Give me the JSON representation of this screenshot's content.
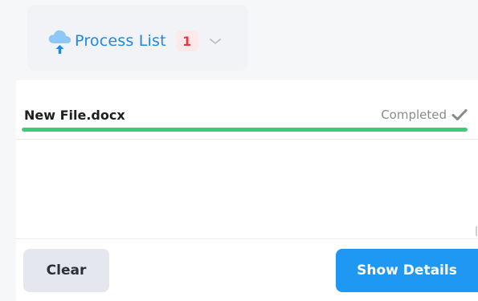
{
  "header": {
    "title": "Process List",
    "count": "1",
    "icons": {
      "cloud": "cloud-upload-icon",
      "chevron": "chevron-down-icon"
    }
  },
  "files": [
    {
      "name": "New File.docx",
      "status": "Completed",
      "progress": 1.0
    }
  ],
  "footer": {
    "clear_label": "Clear",
    "show_details_label": "Show Details"
  },
  "colors": {
    "accent": "#1e88e5",
    "badge_bg": "#fde8ea",
    "badge_text": "#e23a4a",
    "progress": "#3ecb7a",
    "primary_button": "#1e98f3",
    "secondary_button": "#e4e7ee"
  }
}
